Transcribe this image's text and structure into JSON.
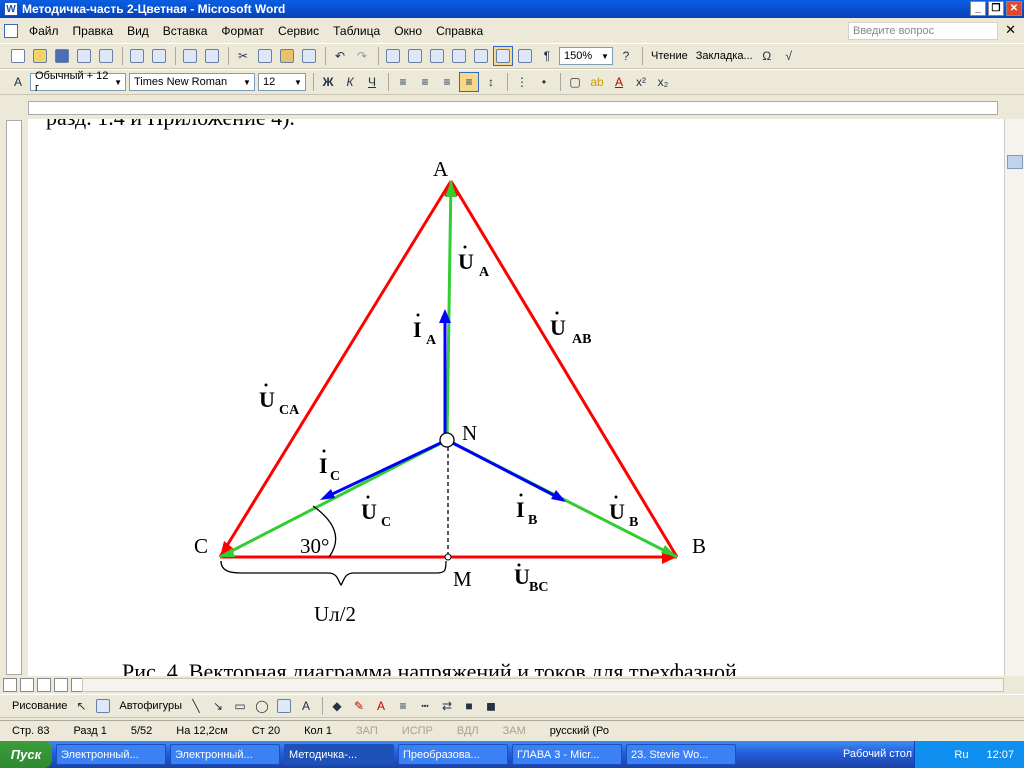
{
  "window": {
    "title": "Методичка-часть 2-Цветная - Microsoft Word"
  },
  "menu": [
    "Файл",
    "Правка",
    "Вид",
    "Вставка",
    "Формат",
    "Сервис",
    "Таблица",
    "Окно",
    "Справка"
  ],
  "ask_placeholder": "Введите вопрос",
  "toolbar": {
    "zoom": "150%",
    "read_label": "Чтение",
    "bookmarks_label": "Закладка...",
    "style": "Обычный + 12 г",
    "font": "Times New Roman",
    "size": "12"
  },
  "page": {
    "top_text": "разд. 1.4 и Приложение 4).",
    "caption": "Рис. 4. Векторная диаграмма напряжений и токов для трехфазной",
    "figure": {
      "vertex_A": "A",
      "vertex_B": "B",
      "vertex_C": "C",
      "point_N": "N",
      "point_M": "M",
      "angle": "30°",
      "half_line": "Uл/2",
      "U_A": "U",
      "U_A_sub": "A",
      "U_B": "U",
      "U_B_sub": "B",
      "U_C": "U",
      "U_C_sub": "C",
      "U_AB": "U",
      "U_AB_sub": "AB",
      "U_BC": "U",
      "U_BC_sub": "BC",
      "U_CA": "U",
      "U_CA_sub": "CA",
      "I_A": "I",
      "I_A_sub": "A",
      "I_B": "I",
      "I_B_sub": "B",
      "I_C": "I",
      "I_C_sub": "C"
    },
    "colors": {
      "line_voltage": "#ff0000",
      "phase_voltage": "#33cc33",
      "current": "#0000ff"
    }
  },
  "draw_toolbar": {
    "drawing": "Рисование",
    "autoshapes": "Автофигуры"
  },
  "status": {
    "page": "Стр. 83",
    "section": "Разд 1",
    "pages": "5/52",
    "at": "На 12,2см",
    "line": "Ст 20",
    "col": "Кол 1",
    "rec": "ЗАП",
    "trk": "ИСПР",
    "ext": "ВДЛ",
    "ovr": "ЗАМ",
    "lang": "русский (Ро"
  },
  "taskbar": {
    "start": "Пуск",
    "tasks": [
      "Электронный...",
      "Электронный...",
      "Методичка-...",
      "Преобразова...",
      "ГЛАВА 3 - Micr...",
      "23. Stevie Wo..."
    ],
    "desktop": "Рабочий стол",
    "lang": "Ru",
    "clock": "12:07"
  }
}
